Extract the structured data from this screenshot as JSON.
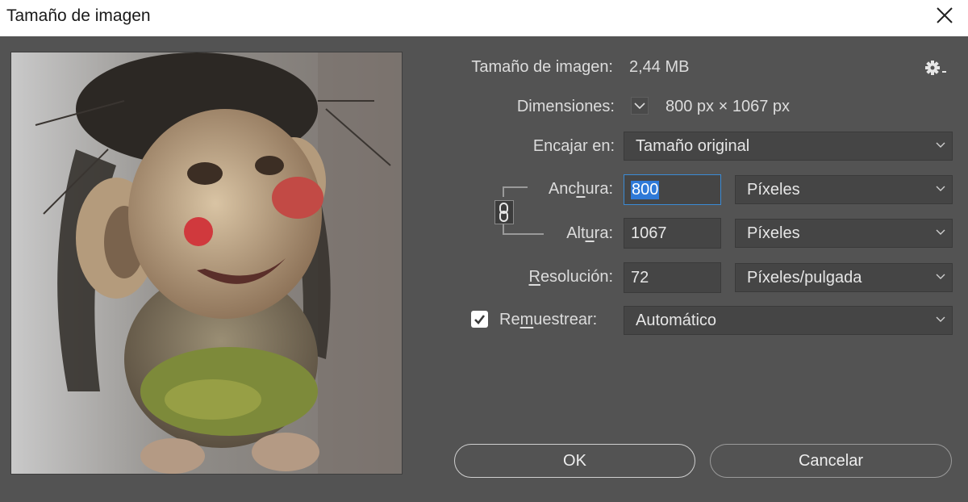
{
  "dialog": {
    "title": "Tamaño de imagen"
  },
  "info": {
    "size_label": "Tamaño de imagen:",
    "size_value": "2,44 MB",
    "dimensions_label": "Dimensiones:",
    "dimensions_value": "800 px × 1067 px"
  },
  "fit": {
    "label": "Encajar en:",
    "value": "Tamaño original"
  },
  "width": {
    "label_pre": "Anc",
    "label_u": "h",
    "label_post": "ura:",
    "value": "800",
    "unit": "Píxeles"
  },
  "height": {
    "label_pre": "Alt",
    "label_u": "u",
    "label_post": "ra:",
    "value": "1067",
    "unit": "Píxeles"
  },
  "resolution": {
    "label_u": "R",
    "label_post": "esolución:",
    "value": "72",
    "unit": "Píxeles/pulgada"
  },
  "resample": {
    "label_pre": "Re",
    "label_u": "m",
    "label_post": "uestrear:",
    "checked": true,
    "value": "Automático"
  },
  "buttons": {
    "ok": "OK",
    "cancel": "Cancelar"
  },
  "icons": {
    "close": "close-icon",
    "gear": "gear-icon",
    "link": "chain-link-icon",
    "chevron": "chevron-down-icon",
    "check": "check-icon"
  },
  "colors": {
    "panel": "#535353",
    "field": "#454545",
    "highlight": "#2f7ad8",
    "titlebar": "#ffffff"
  }
}
